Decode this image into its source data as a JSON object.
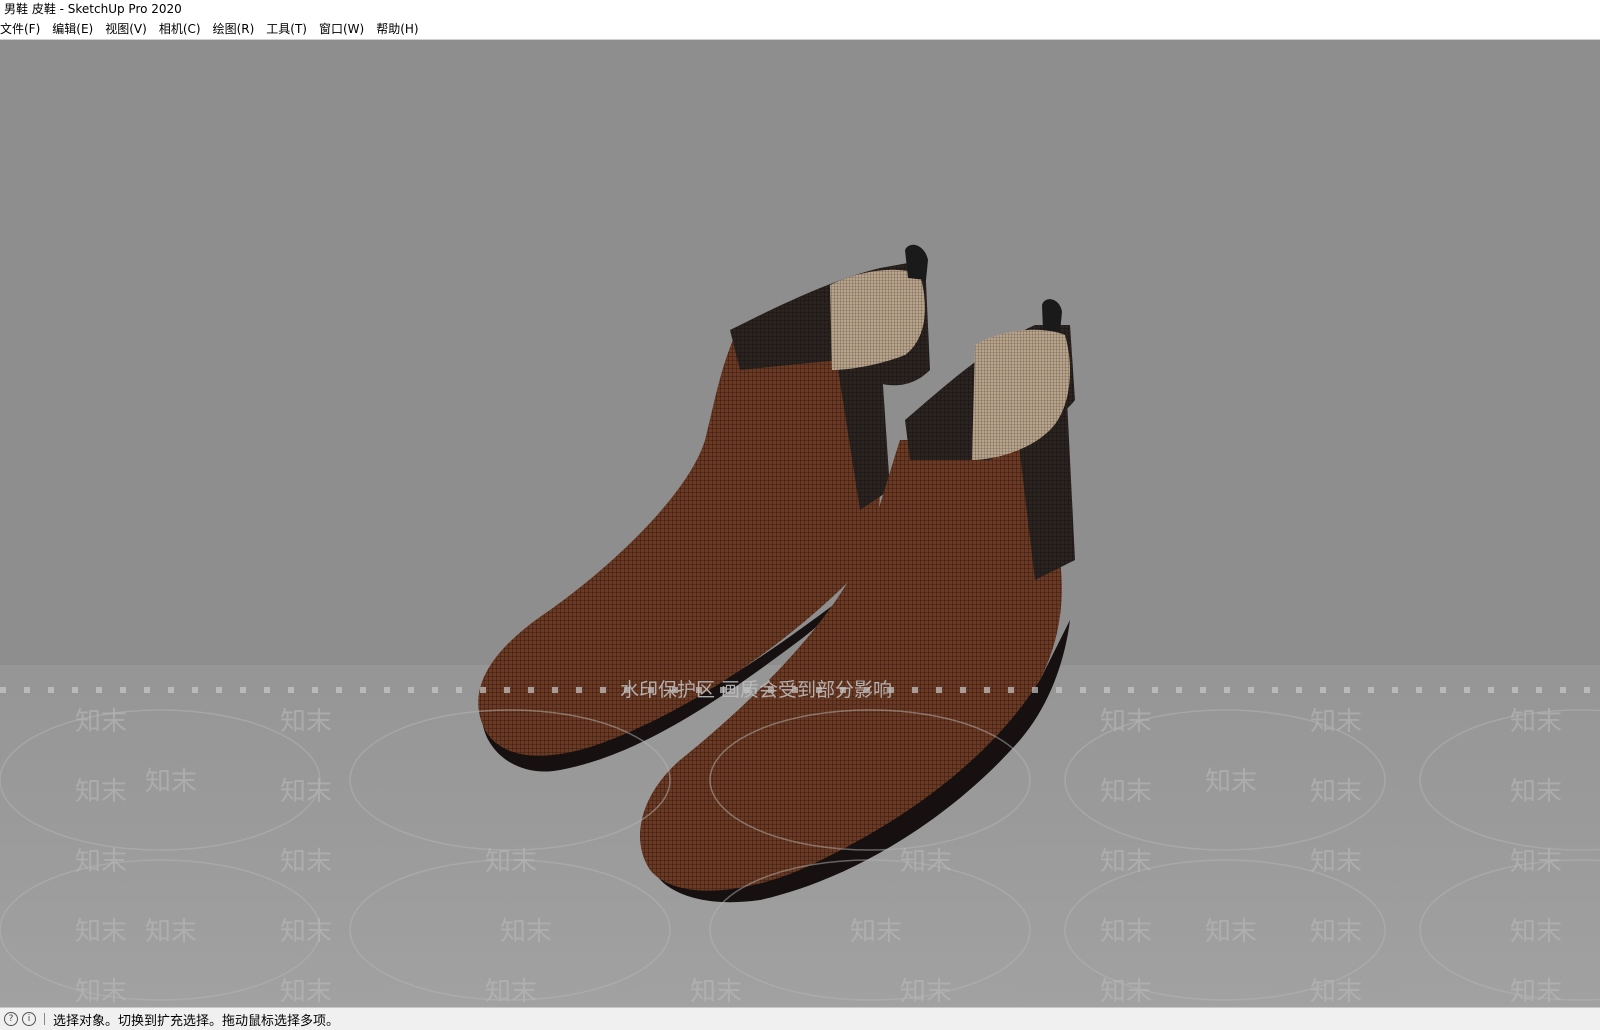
{
  "window": {
    "title": "男鞋 皮鞋 - SketchUp Pro 2020"
  },
  "menu": {
    "items": [
      {
        "id": "file",
        "label": "文件(F)"
      },
      {
        "id": "edit",
        "label": "编辑(E)"
      },
      {
        "id": "view",
        "label": "视图(V)"
      },
      {
        "id": "camera",
        "label": "相机(C)"
      },
      {
        "id": "draw",
        "label": "绘图(R)"
      },
      {
        "id": "tools",
        "label": "工具(T)"
      },
      {
        "id": "window",
        "label": "窗口(W)"
      },
      {
        "id": "help",
        "label": "帮助(H)"
      }
    ]
  },
  "viewport": {
    "background": "#8e8e8e",
    "model_color": "#5a3222",
    "watermark_banner": "水印保护区  画质会受到部分影响",
    "watermark_text": "知末"
  },
  "status": {
    "icons": [
      "help-icon",
      "info-icon"
    ],
    "message": "选择对象。切换到扩充选择。拖动鼠标选择多项。"
  }
}
